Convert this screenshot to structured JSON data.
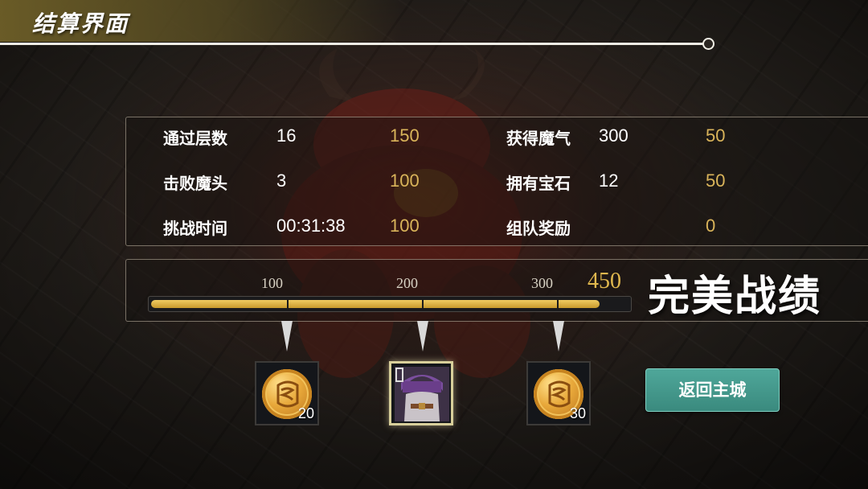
{
  "screen_title": "结算界面",
  "stats": [
    {
      "label": "通过层数",
      "value": "16",
      "points": "150"
    },
    {
      "label": "击败魔头",
      "value": "3",
      "points": "100"
    },
    {
      "label": "挑战时间",
      "value": "00:31:38",
      "points": "100"
    },
    {
      "label": "获得魔气",
      "value": "300",
      "points": "50"
    },
    {
      "label": "拥有宝石",
      "value": "12",
      "points": "50"
    },
    {
      "label": "组队奖励",
      "value": "",
      "points": "0"
    }
  ],
  "progress": {
    "milestones": [
      "100",
      "200",
      "300"
    ],
    "total_score": "450",
    "fill_fraction": 0.94,
    "rating": "完美战绩"
  },
  "rewards": [
    {
      "icon": "gold-coin-icon",
      "quantity": "20"
    },
    {
      "icon": "hero-portrait-icon",
      "quantity": "",
      "selected": true
    },
    {
      "icon": "gold-coin-icon",
      "quantity": "30"
    }
  ],
  "return_button": "返回主城",
  "colors": {
    "accent_gold": "#d9b45a",
    "bar_fill": "#e8b840",
    "button_teal": "#44998c",
    "title_band": "#6e5f28"
  }
}
